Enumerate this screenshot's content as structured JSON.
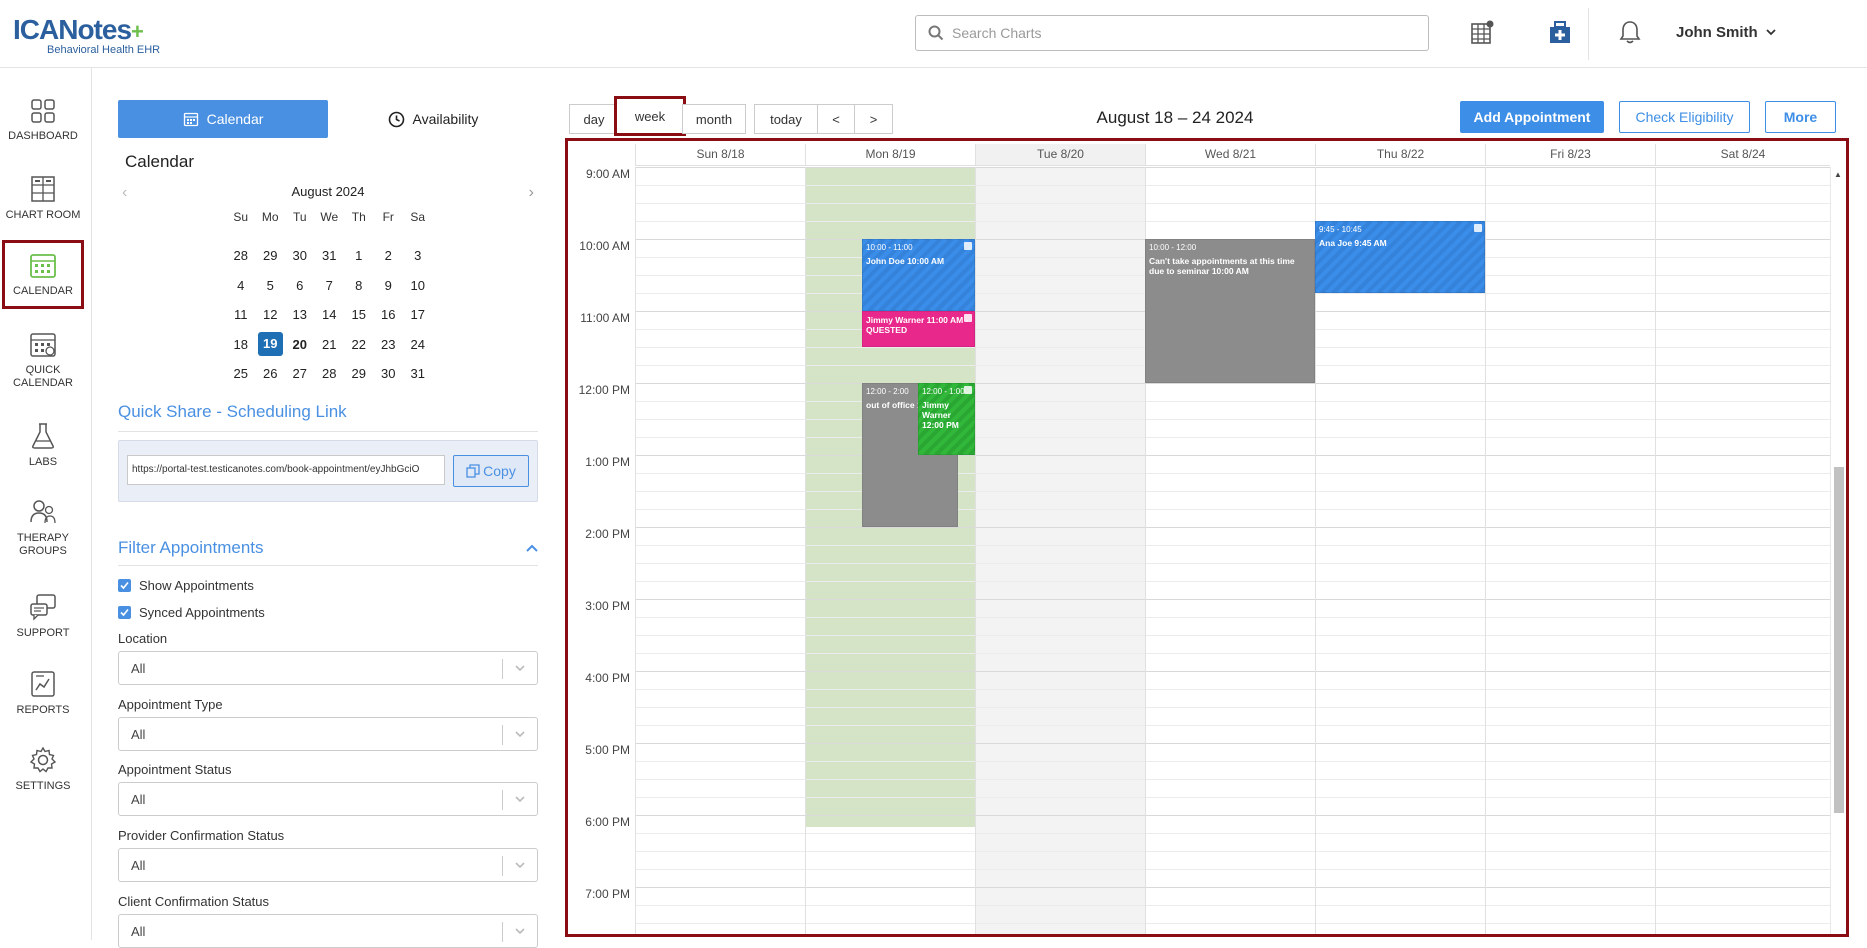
{
  "app": {
    "brand": "ICANotes",
    "subtitle": "Behavioral Health EHR",
    "accent": "#4a90e2",
    "highlight": "#8b0d14"
  },
  "header": {
    "search_placeholder": "Search Charts",
    "user_name": "John Smith"
  },
  "nav": {
    "items": [
      {
        "label": "DASHBOARD",
        "icon": "dashboard-icon"
      },
      {
        "label": "CHART ROOM",
        "icon": "chart-room-icon"
      },
      {
        "label": "CALENDAR",
        "icon": "calendar-icon",
        "active": true
      },
      {
        "label": "QUICK CALENDAR",
        "icon": "quick-calendar-icon"
      },
      {
        "label": "LABS",
        "icon": "flask-icon"
      },
      {
        "label": "THERAPY GROUPS",
        "icon": "therapy-groups-icon"
      },
      {
        "label": "SUPPORT",
        "icon": "support-icon"
      },
      {
        "label": "REPORTS",
        "icon": "reports-icon"
      },
      {
        "label": "SETTINGS",
        "icon": "gear-icon"
      }
    ]
  },
  "panel": {
    "tab_calendar": "Calendar",
    "tab_availability": "Availability",
    "calendar_heading": "Calendar",
    "mini_month": "August 2024",
    "dow": [
      "Su",
      "Mo",
      "Tu",
      "We",
      "Th",
      "Fr",
      "Sa"
    ],
    "weeks": [
      [
        "28",
        "29",
        "30",
        "31",
        "1",
        "2",
        "3"
      ],
      [
        "4",
        "5",
        "6",
        "7",
        "8",
        "9",
        "10"
      ],
      [
        "11",
        "12",
        "13",
        "14",
        "15",
        "16",
        "17"
      ],
      [
        "18",
        "19",
        "20",
        "21",
        "22",
        "23",
        "24"
      ],
      [
        "25",
        "26",
        "27",
        "28",
        "29",
        "30",
        "31"
      ]
    ],
    "today": "19",
    "quick_share_title": "Quick Share - Scheduling Link",
    "share_link": "https://portal-test.testicanotes.com/book-appointment/eyJhbGciO",
    "copy_label": "Copy",
    "filter_title": "Filter Appointments",
    "show_appointments": "Show Appointments",
    "synced_appointments": "Synced Appointments",
    "filters": [
      {
        "label": "Location",
        "value": "All"
      },
      {
        "label": "Appointment Type",
        "value": "All"
      },
      {
        "label": "Appointment Status",
        "value": "All"
      },
      {
        "label": "Provider Confirmation Status",
        "value": "All"
      },
      {
        "label": "Client Confirmation Status",
        "value": "All"
      }
    ]
  },
  "toolbar": {
    "day": "day",
    "week": "week",
    "month": "month",
    "today": "today",
    "prev": "<",
    "next": ">",
    "range": "August 18 – 24 2024",
    "add_appointment": "Add Appointment",
    "check_eligibility": "Check Eligibility",
    "more": "More"
  },
  "week": {
    "days": [
      "Sun 8/18",
      "Mon 8/19",
      "Tue 8/20",
      "Wed 8/21",
      "Thu 8/22",
      "Fri 8/23",
      "Sat 8/24"
    ],
    "times": [
      "9:00 AM",
      "10:00 AM",
      "11:00 AM",
      "12:00 PM",
      "1:00 PM",
      "2:00 PM",
      "3:00 PM",
      "4:00 PM",
      "5:00 PM",
      "6:00 PM",
      "7:00 PM"
    ],
    "events": [
      {
        "time": "10:00 - 11:00",
        "title": "John Doe 10:00 AM"
      },
      {
        "time": "",
        "title": "Jimmy Warner 11:00 AM - QUESTED"
      },
      {
        "time": "12:00 - 2:00",
        "title": "out of office 12"
      },
      {
        "time": "12:00 - 1:00",
        "title": "Jimmy Warner 12:00 PM"
      },
      {
        "time": "10:00 - 12:00",
        "title": "Can't take appointments at this time due to seminar 10:00 AM"
      },
      {
        "time": "9:45 - 10:45",
        "title": "Ana Joe 9:45 AM"
      }
    ]
  }
}
